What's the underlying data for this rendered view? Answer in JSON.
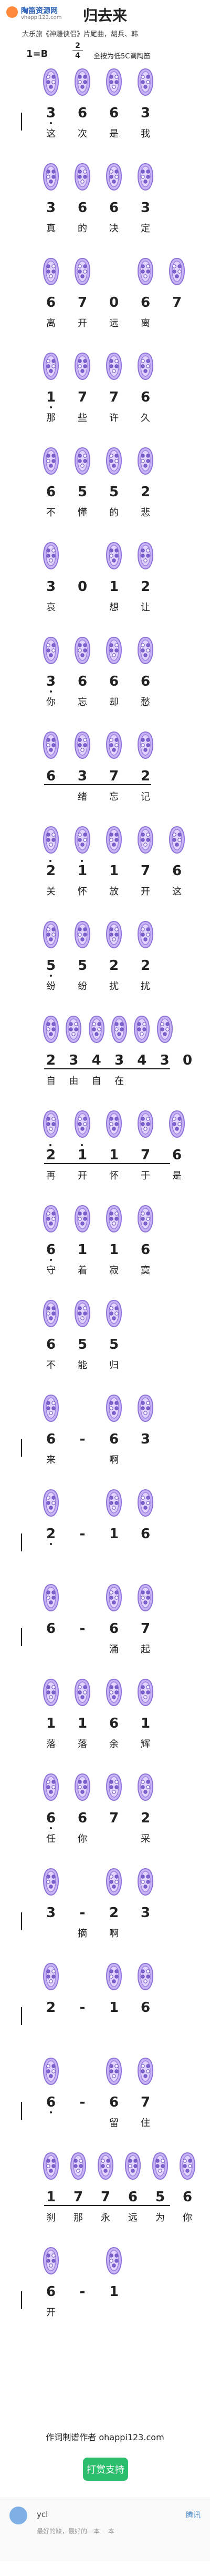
{
  "site": {
    "brand": "陶笛资源网",
    "url": "vhappi123.com"
  },
  "song": {
    "title": "归去来",
    "subtitle": "大乐旅《神雕侠侣》片尾曲，胡兵、韩",
    "key": "1=B",
    "meter_top": "2",
    "meter_bottom": "4",
    "tempo_text": "全按为低5C调陶笛"
  },
  "footer": {
    "credit": "作词制谱作者 ohappi123.com",
    "support_button": "打赏支持"
  },
  "comment": {
    "user": "ycl",
    "action": "腾讯",
    "text": "最好的缺，最好的一本 一本"
  },
  "phrases": [
    {
      "notes": [
        "3",
        "6",
        "6",
        "3"
      ],
      "lyrics": [
        "这",
        "次",
        "是",
        "我"
      ]
    },
    {
      "notes": [
        "3",
        "6",
        "6",
        "3"
      ],
      "lyrics": [
        "真",
        "的",
        "决",
        "定"
      ]
    },
    {
      "notes": [
        "6",
        "7",
        "0",
        "6",
        "7"
      ],
      "lyrics": [
        "离",
        "开",
        "远",
        "离"
      ]
    },
    {
      "notes": [
        "1",
        "7",
        "7",
        "6"
      ],
      "lyrics": [
        "那",
        "些",
        "许",
        "久"
      ]
    },
    {
      "notes": [
        "6",
        "5",
        "5",
        "2"
      ],
      "lyrics": [
        "不",
        "懂",
        "的",
        "悲"
      ]
    },
    {
      "notes": [
        "3",
        "0",
        "1",
        "2"
      ],
      "lyrics": [
        "哀",
        "",
        "想",
        "让"
      ]
    },
    {
      "notes": [
        "3",
        "6",
        "6",
        "6"
      ],
      "lyrics": [
        "你",
        "忘",
        "却",
        "愁"
      ]
    },
    {
      "notes": [
        "6",
        "3",
        "7",
        "2"
      ],
      "lyrics": [
        "",
        "绪",
        "忘",
        "记"
      ]
    },
    {
      "notes": [
        "2",
        "1",
        "1",
        "7",
        "6"
      ],
      "lyrics": [
        "关",
        "怀",
        "放",
        "开",
        "这"
      ]
    },
    {
      "notes": [
        "5",
        "5",
        "2",
        "2"
      ],
      "lyrics": [
        "纷",
        "纷",
        "扰",
        "扰"
      ]
    },
    {
      "notes": [
        "2",
        "3",
        "4",
        "3",
        "4",
        "3",
        "0"
      ],
      "lyrics": [
        "自",
        "由",
        "自",
        "在"
      ]
    },
    {
      "notes": [
        "2",
        "1",
        "1",
        "7",
        "6"
      ],
      "lyrics": [
        "再",
        "开",
        "怀",
        "于",
        "是"
      ]
    },
    {
      "notes": [
        "6",
        "1",
        "1",
        "6"
      ],
      "lyrics": [
        "守",
        "着",
        "寂",
        "寞"
      ]
    },
    {
      "notes": [
        "6",
        "5",
        "5"
      ],
      "lyrics": [
        "不",
        "能",
        "归"
      ]
    },
    {
      "notes": [
        "6",
        "-",
        "6",
        "3"
      ],
      "lyrics": [
        "来",
        "",
        "啊",
        ""
      ]
    },
    {
      "notes": [
        "2",
        "-",
        "1",
        "6"
      ],
      "lyrics": [
        "",
        "",
        "",
        ""
      ]
    },
    {
      "notes": [
        "6",
        "-",
        "6",
        "7"
      ],
      "lyrics": [
        "",
        "",
        "涌",
        "起"
      ]
    },
    {
      "notes": [
        "1",
        "1",
        "6",
        "1"
      ],
      "lyrics": [
        "落",
        "落",
        "余",
        "辉"
      ]
    },
    {
      "notes": [
        "6",
        "6",
        "7",
        "2"
      ],
      "lyrics": [
        "任",
        "你",
        "",
        "采"
      ]
    },
    {
      "notes": [
        "3",
        "-",
        "2",
        "3"
      ],
      "lyrics": [
        "",
        "摘",
        "啊",
        ""
      ]
    },
    {
      "notes": [
        "2",
        "-",
        "1",
        "6"
      ],
      "lyrics": [
        "",
        "",
        "",
        ""
      ]
    },
    {
      "notes": [
        "6",
        "-",
        "6",
        "7"
      ],
      "lyrics": [
        "",
        "",
        "留",
        "住"
      ]
    },
    {
      "notes": [
        "1",
        "7",
        "7",
        "6",
        "5",
        "6"
      ],
      "lyrics": [
        "刹",
        "那",
        "永",
        "远",
        "为",
        "你"
      ]
    },
    {
      "notes": [
        "6",
        "-",
        "1"
      ],
      "lyrics": [
        "开",
        "",
        ""
      ]
    }
  ]
}
